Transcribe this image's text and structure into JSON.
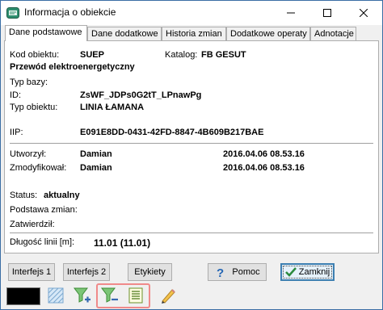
{
  "window": {
    "title": "Informacja o obiekcie"
  },
  "tabs": [
    {
      "label": "Dane podstawowe"
    },
    {
      "label": "Dane dodatkowe"
    },
    {
      "label": "Historia zmian"
    },
    {
      "label": "Dodatkowe operaty"
    },
    {
      "label": "Adnotacje"
    }
  ],
  "basic": {
    "kod_label": "Kod obiektu:",
    "kod_value": "SUEP",
    "katalog_label": "Katalog:",
    "katalog_value": "FB GESUT",
    "description": "Przewód elektroenergetyczny",
    "typ_bazy_label": "Typ bazy:",
    "id_label": "ID:",
    "id_value": "ZsWF_JDPs0G2tT_LPnawPg",
    "typ_obiektu_label": "Typ obiektu:",
    "typ_obiektu_value": "LINIA ŁAMANA",
    "iip_label": "IIP:",
    "iip_value": "E091E8DD-0431-42FD-8847-4B609B217BAE"
  },
  "audit": {
    "utworzyl_label": "Utworzył:",
    "utworzyl_value": "Damian",
    "utworzyl_date": "2016.04.06 08.53.16",
    "zmodyfikowal_label": "Zmodyfikował:",
    "zmodyfikowal_value": "Damian",
    "zmodyfikowal_date": "2016.04.06 08.53.16"
  },
  "status": {
    "status_label": "Status:",
    "status_value": "aktualny",
    "podstawa_label": "Podstawa zmian:",
    "zatwierdzil_label": "Zatwierdził:"
  },
  "length": {
    "label": "Długość linii [m]:",
    "value": "11.01 (11.01)"
  },
  "buttons": {
    "interfejs1": "Interfejs 1",
    "interfejs2": "Interfejs 2",
    "etykiety": "Etykiety",
    "pomoc": "Pomoc",
    "zamknij": "Zamknij"
  },
  "toolbar": {
    "color_swatch": "#000000",
    "icons": [
      "color-swatch",
      "hatch-pattern-icon",
      "filter-add-icon",
      "filter-remove-icon",
      "list-icon",
      "pencil-icon"
    ]
  },
  "colors": {
    "highlight_border": "#f08a8a",
    "accent_blue": "#3c7fb1"
  }
}
